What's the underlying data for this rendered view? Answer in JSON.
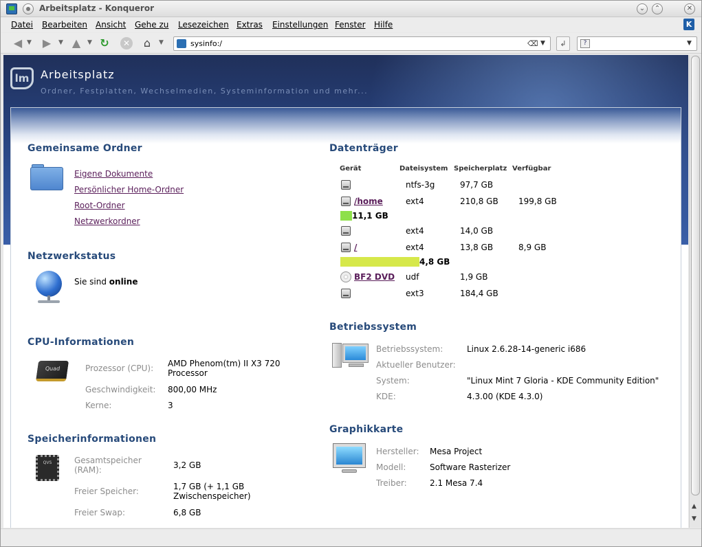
{
  "window": {
    "title": "Arbeitsplatz - Konqueror",
    "buttons": {
      "minimize": "⌄",
      "maximize": "⌃",
      "close": "✕"
    }
  },
  "menu": [
    "Datei",
    "Bearbeiten",
    "Ansicht",
    "Gehe zu",
    "Lesezeichen",
    "Extras",
    "Einstellungen",
    "Fenster",
    "Hilfe"
  ],
  "toolbar": {
    "back_icon": "back-arrow-icon",
    "forward_icon": "forward-arrow-icon",
    "up_icon": "up-arrow-icon",
    "reload_icon": "reload-icon",
    "stop_icon": "stop-icon",
    "home_icon": "home-icon",
    "url": "sysinfo:/"
  },
  "header": {
    "title": "Arbeitsplatz",
    "subtitle": "Ordner, Festplatten, Wechselmedien, Systeminformation und mehr..."
  },
  "shared_folders": {
    "title": "Gemeinsame Ordner",
    "links": [
      "Eigene Dokumente",
      "Persönlicher Home-Ordner",
      "Root-Ordner",
      "Netzwerkordner"
    ]
  },
  "network": {
    "title": "Netzwerkstatus",
    "prefix": "Sie sind ",
    "status": "online"
  },
  "cpu": {
    "title": "CPU-Informationen",
    "rows": [
      {
        "label": "Prozessor (CPU):",
        "value": "AMD Phenom(tm) II X3 720 Processor"
      },
      {
        "label": "Geschwindigkeit:",
        "value": "800,00 MHz"
      },
      {
        "label": "Kerne:",
        "value": "3"
      }
    ]
  },
  "memory": {
    "title": "Speicherinformationen",
    "rows": [
      {
        "label": "Gesamtspeicher (RAM):",
        "value": "3,2 GB"
      },
      {
        "label": "Freier Speicher:",
        "value": "1,7 GB (+ 1,1 GB Zwischenspeicher)"
      },
      {
        "label": "Freier Swap:",
        "value": "6,8 GB"
      }
    ]
  },
  "drives": {
    "title": "Datenträger",
    "headers": [
      "Gerät",
      "Dateisystem",
      "Speicherplatz",
      "Verfügbar"
    ],
    "rows": [
      {
        "name": "",
        "icon": "hard-disk-icon",
        "fs": "ntfs-3g",
        "size": "97,7 GB",
        "free": ""
      },
      {
        "name": "/home",
        "icon": "hard-disk-icon",
        "fs": "ext4",
        "size": "210,8 GB",
        "free": "199,8 GB",
        "used": "11,1 GB",
        "used_fraction": 0.053,
        "bar_color": "#8ee04a"
      },
      {
        "name": "",
        "icon": "hard-disk-icon",
        "fs": "ext4",
        "size": "14,0 GB",
        "free": ""
      },
      {
        "name": "/",
        "icon": "hard-disk-icon",
        "fs": "ext4",
        "size": "13,8 GB",
        "free": "8,9 GB",
        "used": "4,8 GB",
        "used_fraction": 0.348,
        "bar_color": "#d6e84a"
      },
      {
        "name": "BF2 DVD",
        "icon": "cd-icon",
        "fs": "udf",
        "size": "1,9 GB",
        "free": ""
      },
      {
        "name": "",
        "icon": "hard-disk-icon",
        "fs": "ext3",
        "size": "184,4 GB",
        "free": ""
      }
    ]
  },
  "os": {
    "title": "Betriebssystem",
    "rows": [
      {
        "label": "Betriebssystem:",
        "value": "Linux 2.6.28-14-generic i686"
      },
      {
        "label": "Aktueller Benutzer:",
        "value": ""
      },
      {
        "label": "System:",
        "value": "\"Linux Mint 7 Gloria - KDE Community Edition\""
      },
      {
        "label": "KDE:",
        "value": "4.3.00 (KDE 4.3.0)"
      }
    ]
  },
  "graphics": {
    "title": "Graphikkarte",
    "rows": [
      {
        "label": "Hersteller:",
        "value": "Mesa Project"
      },
      {
        "label": "Modell:",
        "value": "Software Rasterizer"
      },
      {
        "label": "Treiber:",
        "value": "2.1 Mesa 7.4"
      }
    ]
  },
  "icon_text": {
    "cpu": "Quad",
    "ram": "QVS"
  }
}
